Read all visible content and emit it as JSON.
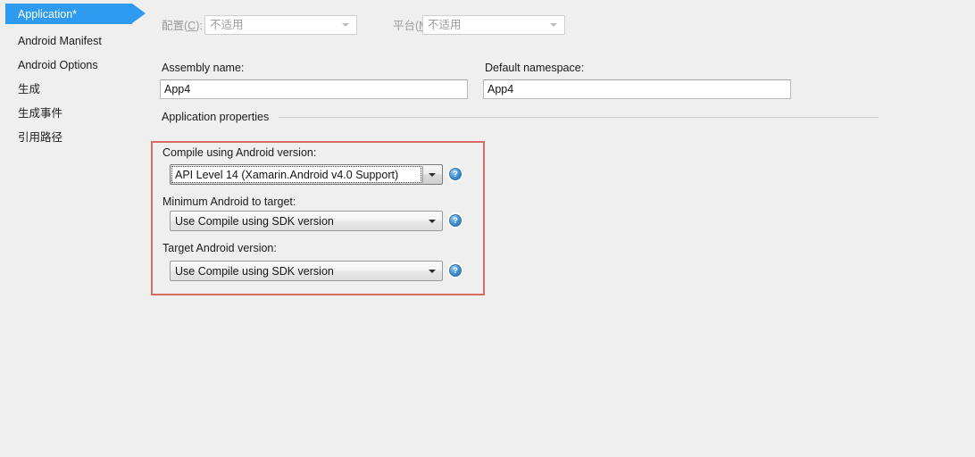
{
  "colors": {
    "background": "#efefef",
    "selection_blue": "#2e9bf0",
    "annotation_red": "#d96a62",
    "text": "#1b1b1b",
    "disabled_text": "#9b9b9b"
  },
  "sidebar": {
    "items": [
      {
        "label": "Application*",
        "selected": true
      },
      {
        "label": "Android Manifest",
        "selected": false
      },
      {
        "label": "Android Options",
        "selected": false
      },
      {
        "label": "生成",
        "selected": false
      },
      {
        "label": "生成事件",
        "selected": false
      },
      {
        "label": "引用路径",
        "selected": false
      }
    ]
  },
  "toolbar": {
    "configuration": {
      "label": "配置(C):",
      "label_prefix": "配置(",
      "mnemonic": "C",
      "label_suffix": "):",
      "value": "不适用",
      "disabled": true
    },
    "platform": {
      "label": "平台(M):",
      "label_prefix": "平台(",
      "mnemonic": "M",
      "label_suffix": "):",
      "value": "不适用",
      "disabled": true
    }
  },
  "main": {
    "assembly_name": {
      "label": "Assembly name:",
      "value": "App4"
    },
    "default_namespace": {
      "label": "Default namespace:",
      "value": "App4"
    },
    "group": {
      "title": "Application properties"
    },
    "fields": [
      {
        "label": "Compile using Android version:",
        "value": "API Level 14 (Xamarin.Android v4.0 Support)",
        "focused": true,
        "help": "?"
      },
      {
        "label": "Minimum Android to target:",
        "value": "Use Compile using SDK version",
        "focused": false,
        "help": "?"
      },
      {
        "label": "Target Android version:",
        "value": "Use Compile using SDK version",
        "focused": false,
        "help": "?"
      }
    ]
  }
}
